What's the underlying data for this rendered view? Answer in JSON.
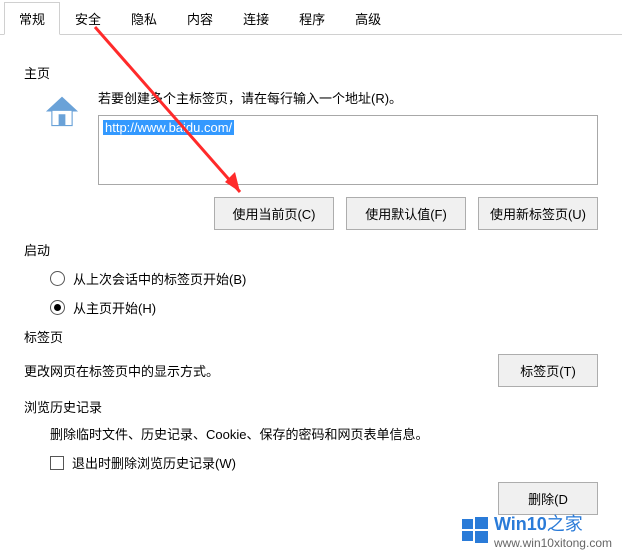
{
  "tabs": {
    "general": "常规",
    "security": "安全",
    "privacy": "隐私",
    "content": "内容",
    "connections": "连接",
    "programs": "程序",
    "advanced": "高级"
  },
  "home": {
    "section": "主页",
    "hint": "若要创建多个主标签页，请在每行输入一个地址(R)。",
    "url": "http://www.baidu.com/",
    "btn_current": "使用当前页(C)",
    "btn_default": "使用默认值(F)",
    "btn_newtab": "使用新标签页(U)"
  },
  "startup": {
    "section": "启动",
    "from_last": "从上次会话中的标签页开始(B)",
    "from_home": "从主页开始(H)"
  },
  "tabsSection": {
    "section": "标签页",
    "desc": "更改网页在标签页中的显示方式。",
    "btn": "标签页(T)"
  },
  "history": {
    "section": "浏览历史记录",
    "desc": "删除临时文件、历史记录、Cookie、保存的密码和网页表单信息。",
    "check": "退出时删除浏览历史记录(W)",
    "btn_delete": "删除(D"
  },
  "watermark": {
    "brand": "Win10",
    "suffix": "之家",
    "url": "www.win10xitong.com"
  }
}
